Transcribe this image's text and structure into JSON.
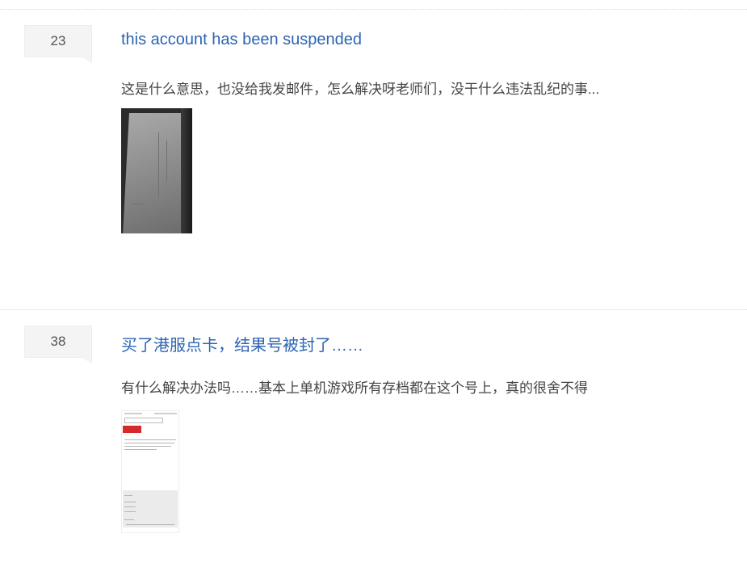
{
  "posts": [
    {
      "reply_count": "23",
      "title": "this account has been suspended",
      "abstract": "这是什么意思，也没给我发邮件，怎么解决呀老师们，没干什么违法乱纪的事..."
    },
    {
      "reply_count": "38",
      "title": "买了港服点卡，结果号被封了……",
      "abstract": "有什么解决办法吗……基本上单机游戏所有存档都在这个号上，真的很舍不得"
    }
  ],
  "colors": {
    "title_link": "#2d64b3",
    "abstract_text": "#444444",
    "badge_bg": "#f4f4f4"
  }
}
